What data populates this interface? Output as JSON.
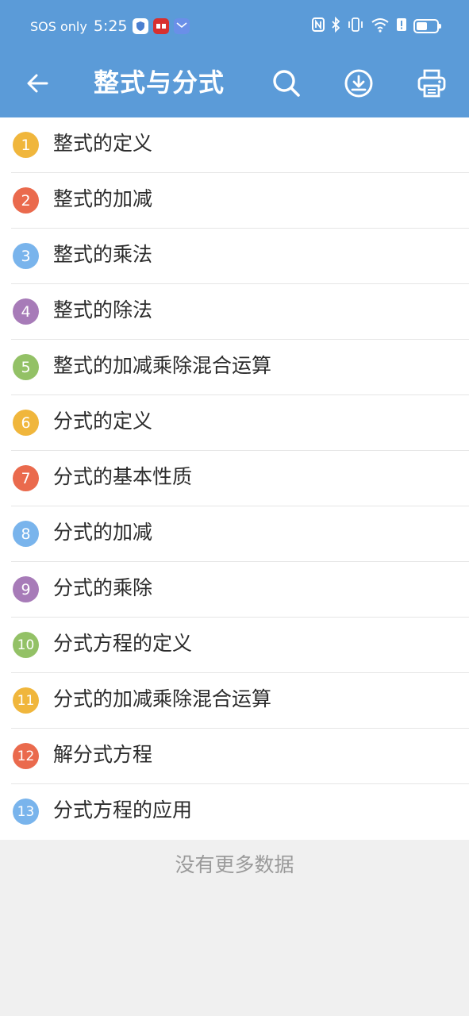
{
  "status_bar": {
    "carrier": "SOS only",
    "time": "5:25",
    "icons": [
      "shield-app-icon",
      "news-app-icon",
      "mail-app-icon"
    ],
    "right_icons": [
      "nfc-icon",
      "bluetooth-icon",
      "vibrate-icon",
      "wifi-icon",
      "alert-icon",
      "battery-icon"
    ],
    "battery_level_percent": 55
  },
  "toolbar": {
    "title": "整式与分式",
    "back_icon": "arrow-left-icon",
    "search_icon": "search-icon",
    "download_icon": "download-icon",
    "print_icon": "printer-icon"
  },
  "colors": {
    "header": "#5b9bd8",
    "yellow": "#f0b63c",
    "red": "#ea6a4d",
    "blue": "#79b4ec",
    "purple": "#a77bb8",
    "green": "#93c166"
  },
  "items": [
    {
      "num": "1",
      "label": "整式的定义",
      "color": "#f0b63c"
    },
    {
      "num": "2",
      "label": "整式的加减",
      "color": "#ea6a4d"
    },
    {
      "num": "3",
      "label": "整式的乘法",
      "color": "#79b4ec"
    },
    {
      "num": "4",
      "label": "整式的除法",
      "color": "#a77bb8"
    },
    {
      "num": "5",
      "label": "整式的加减乘除混合运算",
      "color": "#93c166"
    },
    {
      "num": "6",
      "label": "分式的定义",
      "color": "#f0b63c"
    },
    {
      "num": "7",
      "label": "分式的基本性质",
      "color": "#ea6a4d"
    },
    {
      "num": "8",
      "label": "分式的加减",
      "color": "#79b4ec"
    },
    {
      "num": "9",
      "label": "分式的乘除",
      "color": "#a77bb8"
    },
    {
      "num": "10",
      "label": "分式方程的定义",
      "color": "#93c166"
    },
    {
      "num": "11",
      "label": "分式的加减乘除混合运算",
      "color": "#f0b63c"
    },
    {
      "num": "12",
      "label": "解分式方程",
      "color": "#ea6a4d"
    },
    {
      "num": "13",
      "label": "分式方程的应用",
      "color": "#79b4ec"
    }
  ],
  "footer": {
    "no_more": "没有更多数据"
  }
}
